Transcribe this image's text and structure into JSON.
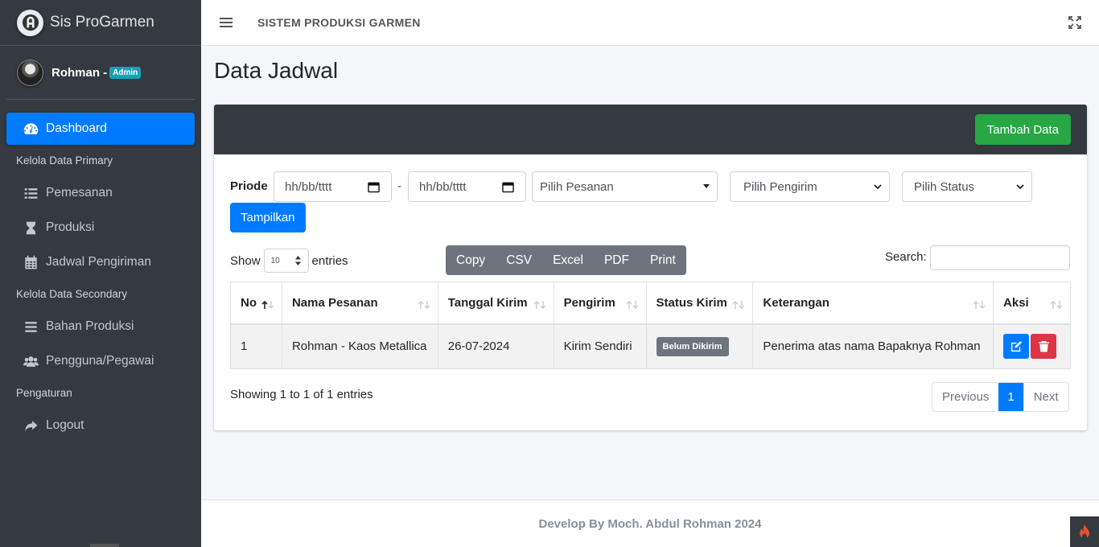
{
  "brand": {
    "name": "Sis ProGarmen"
  },
  "user": {
    "name": "Rohman -",
    "role": "Admin"
  },
  "sidebar": {
    "items": [
      {
        "label": "Dashboard",
        "icon": "tachometer-icon",
        "active": true
      },
      {
        "header": "Kelola Data Primary"
      },
      {
        "label": "Pemesanan",
        "icon": "list-icon"
      },
      {
        "label": "Produksi",
        "icon": "hourglass-icon"
      },
      {
        "label": "Jadwal Pengiriman",
        "icon": "calendar-icon"
      },
      {
        "header": "Kelola Data Secondary"
      },
      {
        "label": "Bahan Produksi",
        "icon": "bars-icon"
      },
      {
        "label": "Pengguna/Pegawai",
        "icon": "users-icon"
      },
      {
        "header": "Pengaturan"
      },
      {
        "label": "Logout",
        "icon": "share-icon"
      }
    ]
  },
  "topbar": {
    "title": "SISTEM PRODUKSI GARMEN"
  },
  "page": {
    "title": "Data Jadwal"
  },
  "card": {
    "add_button": "Tambah Data"
  },
  "filter": {
    "label": "Priode",
    "date_start_placeholder": "hh/bb/tttt",
    "separator": "-",
    "date_end_placeholder": "hh/bb/tttt",
    "pesanan": "Pilih Pesanan",
    "pengirim": "Pilih Pengirim",
    "status": "Pilih Status",
    "submit": "Tampilkan"
  },
  "datatable": {
    "show": "Show",
    "length": "10",
    "entries": "entries",
    "buttons": [
      "Copy",
      "CSV",
      "Excel",
      "PDF",
      "Print"
    ],
    "search_label": "Search:",
    "columns": [
      "No",
      "Nama Pesanan",
      "Tanggal Kirim",
      "Pengirim",
      "Status Kirim",
      "Keterangan",
      "Aksi"
    ],
    "rows": [
      {
        "no": "1",
        "nama": "Rohman - Kaos Metallica",
        "tanggal": "26-07-2024",
        "pengirim": "Kirim Sendiri",
        "status": "Belum Dikirim",
        "keterangan": "Penerima atas nama Bapaknya Rohman"
      }
    ],
    "info": "Showing 1 to 1 of 1 entries",
    "pagination": {
      "previous": "Previous",
      "page": "1",
      "next": "Next"
    }
  },
  "footer": {
    "text": "Develop By Moch. Abdul Rohman 2024"
  },
  "colors": {
    "sidebar": "#343a40",
    "primary": "#007bff",
    "success": "#28a745",
    "danger": "#dc3545",
    "secondary": "#6c757d",
    "info": "#17a2b8"
  }
}
